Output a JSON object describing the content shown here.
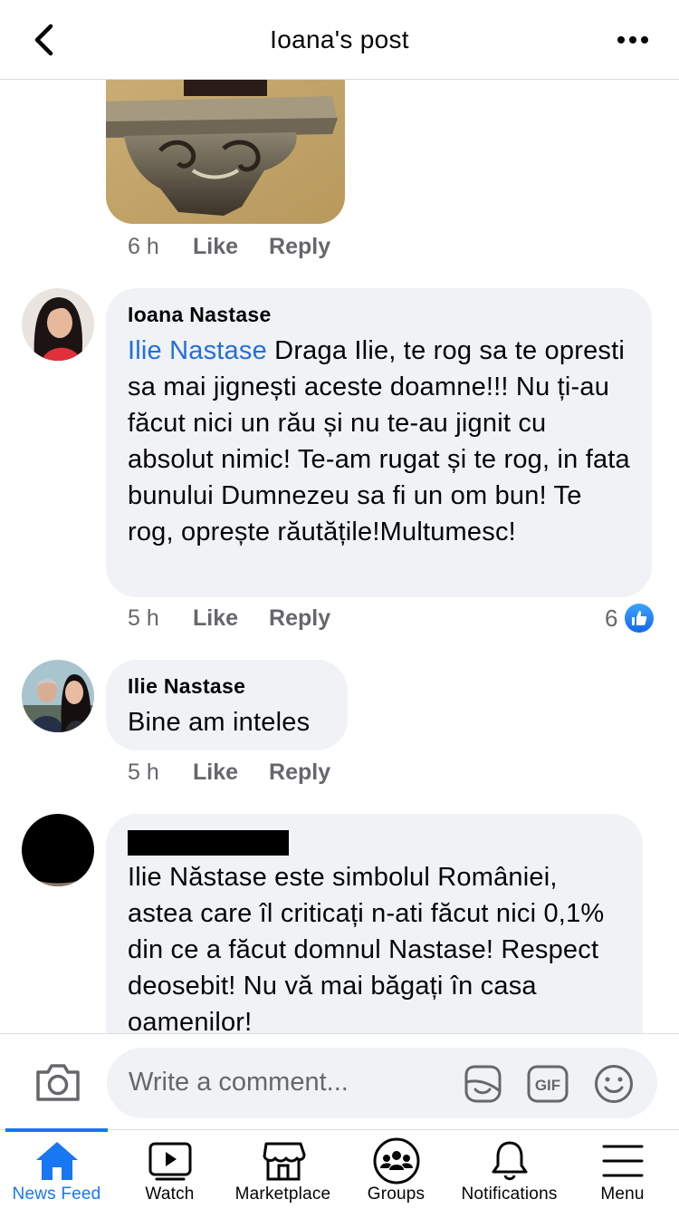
{
  "header": {
    "title": "Ioana's post",
    "back_icon": "chevron-left-icon",
    "more_icon": "more-dots-icon"
  },
  "comments": [
    {
      "time": "6 h",
      "like_label": "Like",
      "reply_label": "Reply"
    },
    {
      "author": "Ioana Nastase",
      "mention": "Ilie Nastase",
      "text": " Draga Ilie, te rog sa te opresti sa mai jignești aceste doamne!!! Nu ți-au făcut nici un rău și nu te-au jignit cu absolut nimic! Te-am rugat și te rog, in fata bunului Dumnezeu sa fi un om bun! Te rog, oprește răutățile!Multumesc!",
      "time": "5 h",
      "like_label": "Like",
      "reply_label": "Reply",
      "reaction_count": "6"
    },
    {
      "author": "Ilie Nastase",
      "text": "Bine am inteles",
      "time": "5 h",
      "like_label": "Like",
      "reply_label": "Reply"
    },
    {
      "author": "",
      "text": "Ilie Năstase este simbolul României, astea care îl criticați n-ati făcut nici 0,1% din ce a făcut domnul Nastase! Respect deosebit! Nu vă mai băgați în casa oamenilor!"
    }
  ],
  "composer": {
    "placeholder": "Write a comment..."
  },
  "nav": {
    "items": [
      {
        "label": "News Feed",
        "icon": "home-icon",
        "active": true
      },
      {
        "label": "Watch",
        "icon": "watch-icon"
      },
      {
        "label": "Marketplace",
        "icon": "marketplace-icon"
      },
      {
        "label": "Groups",
        "icon": "groups-icon"
      },
      {
        "label": "Notifications",
        "icon": "bell-icon"
      },
      {
        "label": "Menu",
        "icon": "menu-icon"
      }
    ]
  },
  "colors": {
    "accent": "#1877f2",
    "mention": "#216fdb",
    "bubble": "#f0f2f5",
    "muted": "#65676b"
  }
}
